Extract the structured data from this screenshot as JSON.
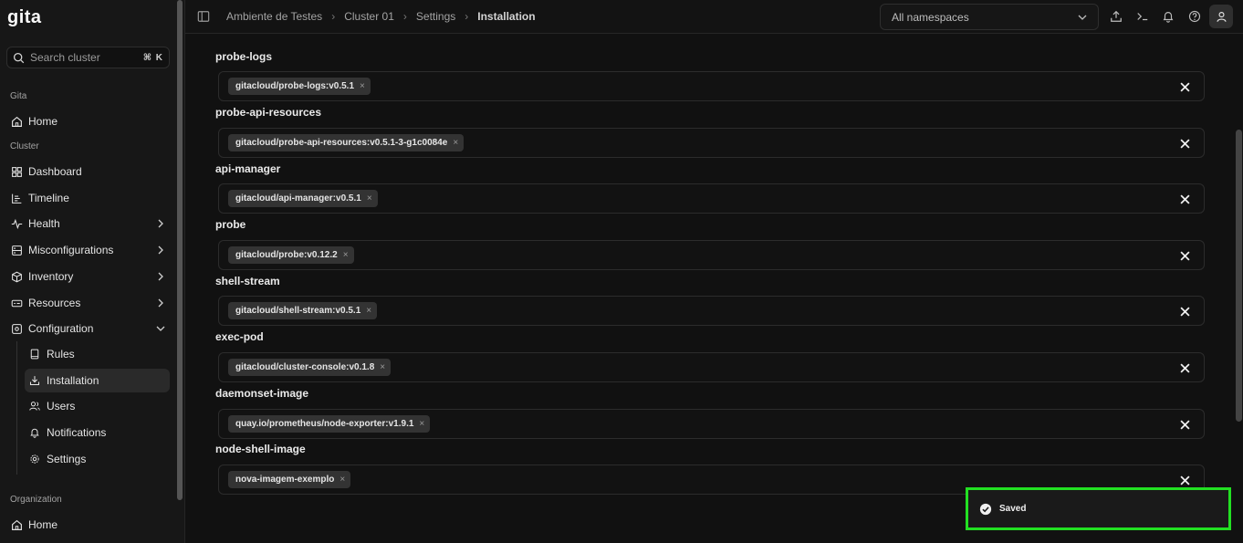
{
  "app": {
    "logo": "gita"
  },
  "sidebar": {
    "search_placeholder": "Search cluster",
    "search_shortcut": "⌘ K",
    "section_gita": "Gita",
    "home": "Home",
    "section_cluster": "Cluster",
    "items": [
      {
        "label": "Dashboard",
        "icon": "grid-icon"
      },
      {
        "label": "Timeline",
        "icon": "timeline-icon"
      },
      {
        "label": "Health",
        "icon": "heartbeat-icon"
      },
      {
        "label": "Misconfigurations",
        "icon": "scan-icon"
      },
      {
        "label": "Inventory",
        "icon": "box-icon"
      },
      {
        "label": "Resources",
        "icon": "server-icon"
      },
      {
        "label": "Configuration",
        "icon": "config-icon"
      }
    ],
    "sub_items": [
      {
        "label": "Rules",
        "icon": "book-icon"
      },
      {
        "label": "Installation",
        "icon": "download-icon"
      },
      {
        "label": "Users",
        "icon": "users-icon"
      },
      {
        "label": "Notifications",
        "icon": "bell-icon"
      },
      {
        "label": "Settings",
        "icon": "gear-icon"
      }
    ],
    "section_org": "Organization",
    "org_home": "Home"
  },
  "header": {
    "breadcrumbs": [
      "Ambiente de Testes",
      "Cluster 01",
      "Settings",
      "Installation"
    ],
    "namespace": "All namespaces"
  },
  "fields": [
    {
      "label": "probe-logs",
      "value": "gitacloud/probe-logs:v0.5.1"
    },
    {
      "label": "probe-api-resources",
      "value": "gitacloud/probe-api-resources:v0.5.1-3-g1c0084e"
    },
    {
      "label": "api-manager",
      "value": "gitacloud/api-manager:v0.5.1"
    },
    {
      "label": "probe",
      "value": "gitacloud/probe:v0.12.2"
    },
    {
      "label": "shell-stream",
      "value": "gitacloud/shell-stream:v0.5.1"
    },
    {
      "label": "exec-pod",
      "value": "gitacloud/cluster-console:v0.1.8"
    },
    {
      "label": "daemonset-image",
      "value": "quay.io/prometheus/node-exporter:v1.9.1"
    },
    {
      "label": "node-shell-image",
      "value": "nova-imagem-exemplo"
    }
  ],
  "chip_remove": "×",
  "toast": {
    "message": "Saved"
  }
}
